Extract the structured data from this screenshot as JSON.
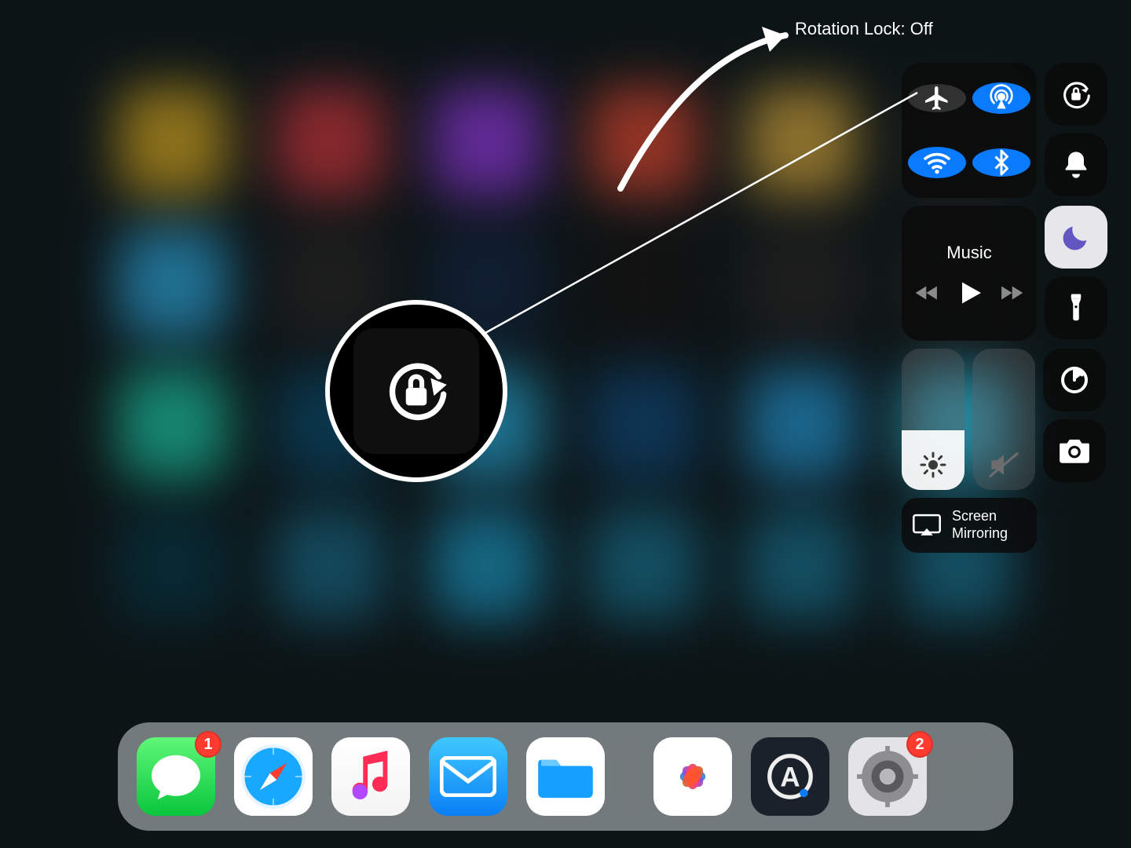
{
  "callout": {
    "label": "Rotation Lock: Off"
  },
  "control_center": {
    "connectivity": {
      "airplane": false,
      "airdrop": true,
      "wifi": true,
      "bluetooth": true
    },
    "side_toggles": {
      "rotation_lock": false,
      "silent": false,
      "do_not_disturb": true,
      "flashlight": false,
      "timer": false,
      "camera": false
    },
    "media": {
      "title_label": "Music"
    },
    "brightness_fill_pct": 42,
    "volume_fill_pct": 0,
    "screen_mirroring_label": "Screen Mirroring"
  },
  "dock": {
    "apps": [
      {
        "name": "messages",
        "badge": "1",
        "bg": "linear-gradient(#5ff777,#09c63d)"
      },
      {
        "name": "safari",
        "bg": "#fff"
      },
      {
        "name": "music",
        "bg": "linear-gradient(#ffffff,#f3f3f3)"
      },
      {
        "name": "mail",
        "bg": "linear-gradient(#3fc0ff,#0a7ff5)"
      },
      {
        "name": "files",
        "bg": "#fff"
      }
    ],
    "recent": [
      {
        "name": "photos",
        "bg": "#fff"
      },
      {
        "name": "app-a",
        "bg": "#1b212b"
      },
      {
        "name": "settings",
        "bg": "#e4e4e6",
        "badge": "2"
      }
    ]
  }
}
